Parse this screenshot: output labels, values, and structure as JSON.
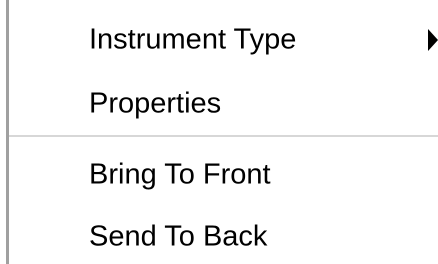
{
  "context_menu": {
    "items": [
      {
        "label": "Instrument Type",
        "has_submenu": true
      },
      {
        "label": "Properties",
        "has_submenu": false
      },
      {
        "label": "Bring To Front",
        "has_submenu": false
      },
      {
        "label": "Send To Back",
        "has_submenu": false
      }
    ],
    "submenu_arrow_icon": "chevron-right-icon",
    "colors": {
      "background": "#ffffff",
      "text": "#000000",
      "separator": "#d7d7d7",
      "border": "#a0a0a0",
      "hover": "#e5f1fb"
    }
  }
}
